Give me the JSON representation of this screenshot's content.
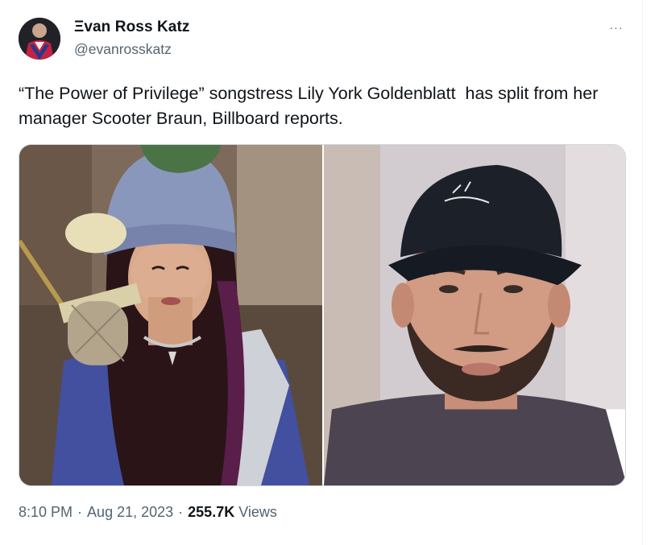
{
  "author": {
    "display_name": "Ξvan Ross Katz",
    "handle": "@evanrosskatz"
  },
  "more_icon": "more-horizontal-icon",
  "more_label": "···",
  "tweet": {
    "text": "“The Power of Privilege” songstress Lily York Goldenblatt  has split from her manager Scooter Braun, Billboard reports."
  },
  "media": [
    {
      "name": "photo-woman-at-microphone"
    },
    {
      "name": "photo-man-in-black-cap"
    }
  ],
  "meta": {
    "time": "8:10 PM",
    "separator": "·",
    "date": "Aug 21, 2023",
    "views_count": "255.7K",
    "views_label": "Views"
  },
  "colors": {
    "text_primary": "#0f1419",
    "text_secondary": "#536471",
    "border": "#cfd9de"
  }
}
